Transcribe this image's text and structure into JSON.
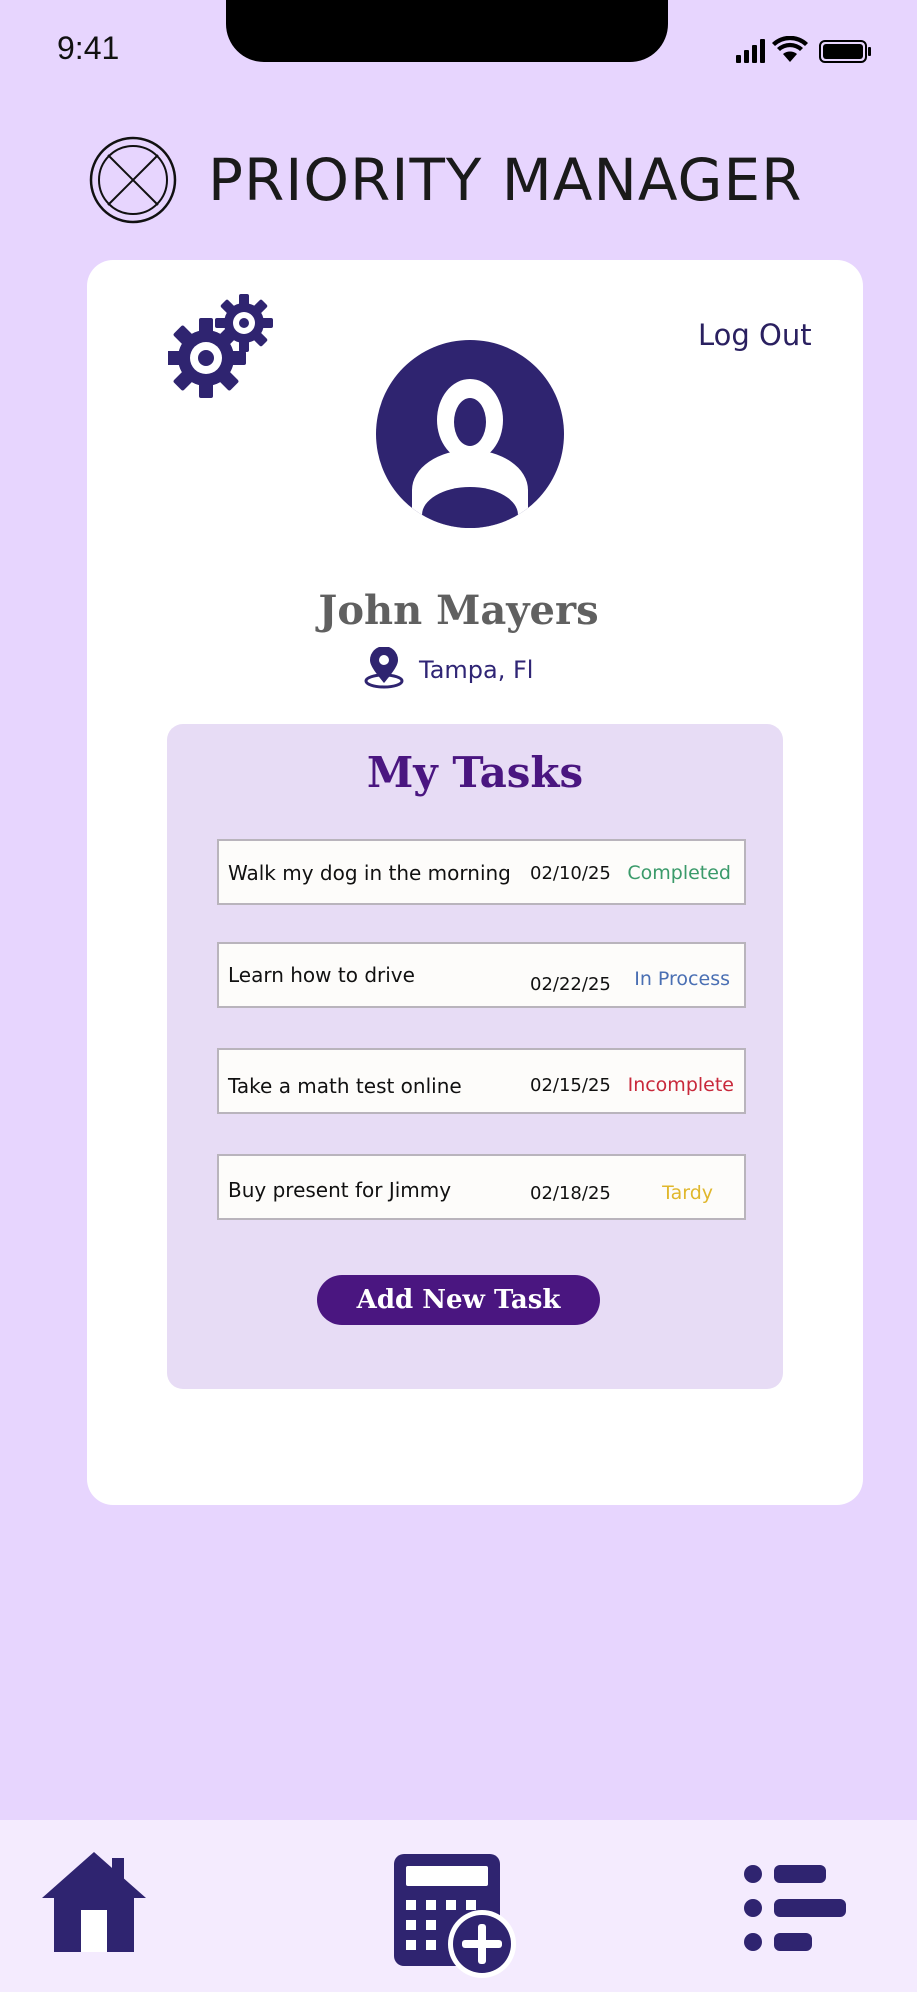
{
  "status_bar": {
    "time": "9:41"
  },
  "header": {
    "title": "PRIORITY MANAGER"
  },
  "profile": {
    "logout_label": "Log Out",
    "name": "John Mayers",
    "location": "Tampa, Fl"
  },
  "tasks": {
    "title": "My Tasks",
    "items": [
      {
        "name": "Walk my dog in the morning",
        "date": "02/10/25",
        "status": "Completed"
      },
      {
        "name": "Learn how to drive",
        "date": "02/22/25",
        "status": "In Process"
      },
      {
        "name": "Take a math test online",
        "date": "02/15/25",
        "status": "Incomplete"
      },
      {
        "name": "Buy present for Jimmy",
        "date": "02/18/25",
        "status": "Tardy"
      }
    ],
    "add_button_label": "Add New Task"
  },
  "colors": {
    "background": "#e7d5fe",
    "accent": "#4a1680",
    "icon": "#2f2470",
    "status_completed": "#3a9a6a",
    "status_in_process": "#4a6fb3",
    "status_incomplete": "#c8283a",
    "status_tardy": "#e0b72c"
  },
  "icons": {
    "logo": "crossed-circle-logo-icon",
    "settings": "gears-icon",
    "avatar": "user-avatar-icon",
    "location": "location-pin-icon",
    "nav_home": "home-icon",
    "nav_calendar_add": "calendar-add-icon",
    "nav_list": "list-icon"
  }
}
